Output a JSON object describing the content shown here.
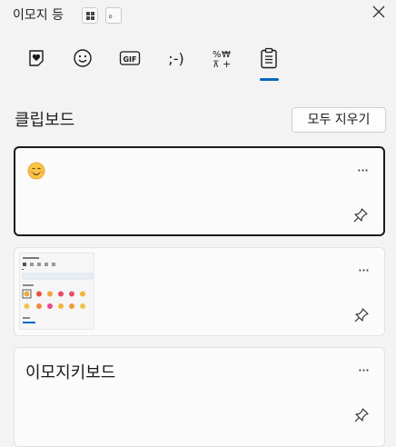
{
  "window": {
    "title": "이모지 등",
    "dot_label": "。"
  },
  "tabs": [
    {
      "name": "kaomoji-heart",
      "label": ""
    },
    {
      "name": "emoji",
      "label": ""
    },
    {
      "name": "gif",
      "label": "GIF"
    },
    {
      "name": "kaomoji",
      "label": ";-)"
    },
    {
      "name": "symbols",
      "label": ""
    },
    {
      "name": "clipboard",
      "label": ""
    }
  ],
  "clipboard": {
    "section_title": "클립보드",
    "clear_all_label": "모두 지우기",
    "more_label": "···",
    "items": [
      {
        "type": "emoji",
        "content": "😊"
      },
      {
        "type": "image",
        "content": ""
      },
      {
        "type": "text",
        "content": "이모지키보드"
      }
    ]
  },
  "colors": {
    "accent": "#0067c0",
    "background": "#f3f3f3",
    "card": "#fbfbfb"
  }
}
